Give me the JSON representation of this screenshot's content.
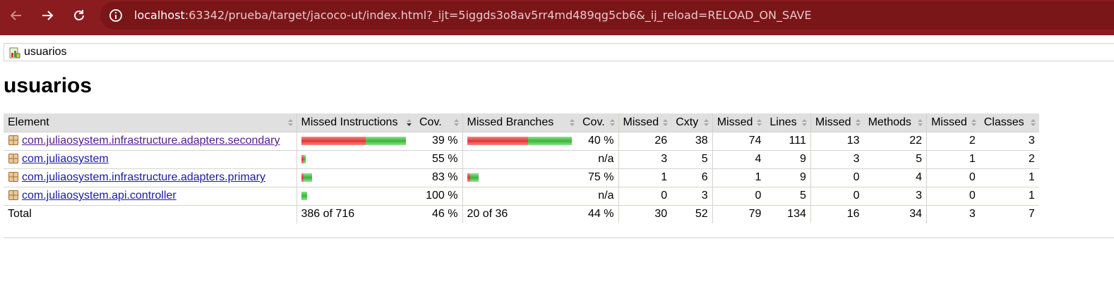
{
  "browser": {
    "url_host": "localhost",
    "url_rest": ":63342/prueba/target/jacoco-ut/index.html?_ijt=5iggds3o8av5rr4md489qg5cb6&_ij_reload=RELOAD_ON_SAVE"
  },
  "breadcrumb": {
    "label": "usuarios"
  },
  "page": {
    "title": "usuarios"
  },
  "table": {
    "headers": [
      "Element",
      "Missed Instructions",
      "Cov.",
      "Missed Branches",
      "Cov.",
      "Missed",
      "Cxty",
      "Missed",
      "Lines",
      "Missed",
      "Methods",
      "Missed",
      "Classes"
    ],
    "rows": [
      {
        "element": "com.juliaosystem.infrastructure.adapters.secondary",
        "instr_missed_frac": 0.6148,
        "instr_covered_frac": 0.3852,
        "instr_cov": "39 %",
        "branch_missed_frac": 0.5833,
        "branch_covered_frac": 0.4167,
        "branch_cov": "40 %",
        "cxty_missed": "26",
        "cxty": "38",
        "lines_missed": "74",
        "lines": "111",
        "methods_missed": "13",
        "methods": "22",
        "classes_missed": "2",
        "classes": "3"
      },
      {
        "element": "com.juliaosystem",
        "instr_missed_frac": 0.0112,
        "instr_covered_frac": 0.014,
        "instr_cov": "55 %",
        "branch_missed_frac": 0,
        "branch_covered_frac": 0,
        "branch_cov": "n/a",
        "cxty_missed": "3",
        "cxty": "5",
        "lines_missed": "4",
        "lines": "9",
        "methods_missed": "3",
        "methods": "5",
        "classes_missed": "1",
        "classes": "2"
      },
      {
        "element": "com.juliaosystem.infrastructure.adapters.primary",
        "instr_missed_frac": 0.0168,
        "instr_covered_frac": 0.0813,
        "instr_cov": "83 %",
        "branch_missed_frac": 0.0278,
        "branch_covered_frac": 0.0833,
        "branch_cov": "75 %",
        "cxty_missed": "1",
        "cxty": "6",
        "lines_missed": "1",
        "lines": "9",
        "methods_missed": "0",
        "methods": "4",
        "classes_missed": "0",
        "classes": "1"
      },
      {
        "element": "com.juliaosystem.api.controller",
        "instr_missed_frac": 0,
        "instr_covered_frac": 0.0563,
        "instr_cov": "100 %",
        "branch_missed_frac": 0,
        "branch_covered_frac": 0,
        "branch_cov": "n/a",
        "cxty_missed": "0",
        "cxty": "3",
        "lines_missed": "0",
        "lines": "5",
        "methods_missed": "0",
        "methods": "3",
        "classes_missed": "0",
        "classes": "1"
      }
    ],
    "total": {
      "label": "Total",
      "instr": "386 of 716",
      "instr_cov": "46 %",
      "branch": "20 of 36",
      "branch_cov": "44 %",
      "cxty_missed": "30",
      "cxty": "52",
      "lines_missed": "79",
      "lines": "134",
      "methods_missed": "16",
      "methods": "34",
      "classes_missed": "3",
      "classes": "7"
    }
  },
  "colors": {
    "toolbar": "#8a1c1f",
    "missed_bar": "#e03434",
    "covered_bar": "#37b737",
    "header_bg": "#e0e0e0"
  }
}
